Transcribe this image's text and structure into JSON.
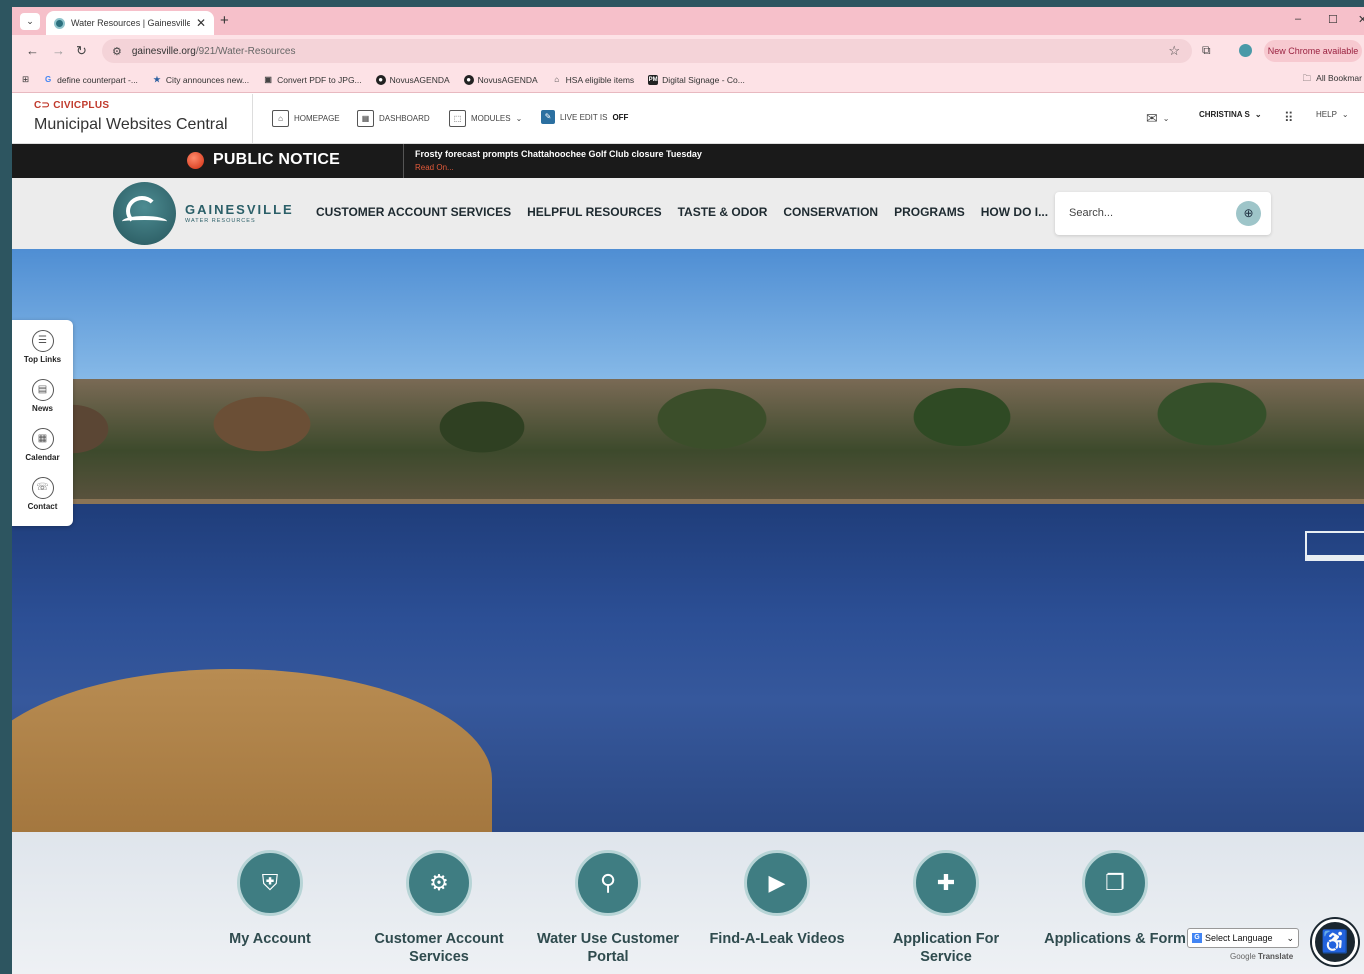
{
  "browser": {
    "tab_title": "Water Resources | Gainesville, G",
    "tab_close": "✕",
    "new_tab": "+",
    "window_buttons": [
      "–",
      "☐",
      "✕"
    ],
    "url_host": "gainesville.org",
    "url_path": "/921/Water-Resources",
    "update_button": "New Chrome available",
    "bookmarks": [
      {
        "icon": "google-icon",
        "label": "define counterpart -..."
      },
      {
        "icon": "city-icon",
        "label": "City announces new..."
      },
      {
        "icon": "convert-icon",
        "label": "Convert PDF to JPG..."
      },
      {
        "icon": "novus-icon",
        "label": "NovusAGENDA"
      },
      {
        "icon": "novus-icon",
        "label": "NovusAGENDA"
      },
      {
        "icon": "hsa-icon",
        "label": "HSA eligible items"
      },
      {
        "icon": "signage-icon",
        "label": "Digital Signage - Co..."
      }
    ],
    "all_bookmarks": "All Bookmar"
  },
  "admin_bar": {
    "brand": "CIVICPLUS",
    "brand_sub": "Municipal Websites Central",
    "homepage": "HOMEPAGE",
    "dashboard": "DASHBOARD",
    "modules": "MODULES",
    "live_edit_label": "LIVE EDIT IS",
    "live_edit_state": "OFF",
    "user": "CHRISTINA S",
    "help": "HELP"
  },
  "notice": {
    "title": "PUBLIC NOTICE",
    "headline": "Frosty forecast prompts Chattahoochee Golf Club closure Tuesday",
    "link": "Read On..."
  },
  "site": {
    "logo_name": "GAINESVILLE",
    "logo_sub": "WATER RESOURCES",
    "nav": [
      "CUSTOMER ACCOUNT SERVICES",
      "HELPFUL RESOURCES",
      "TASTE & ODOR",
      "CONSERVATION",
      "PROGRAMS",
      "HOW DO I..."
    ],
    "search_placeholder": "Search..."
  },
  "side_links": [
    {
      "icon": "list-icon",
      "label": "Top Links"
    },
    {
      "icon": "news-icon",
      "label": "News"
    },
    {
      "icon": "calendar-icon",
      "label": "Calendar"
    },
    {
      "icon": "contact-icon",
      "label": "Contact"
    }
  ],
  "cards": [
    {
      "icon": "shield-user-icon",
      "label": "My Account"
    },
    {
      "icon": "gear-people-icon",
      "label": "Customer Account Services"
    },
    {
      "icon": "faucet-icon",
      "label": "Water Use Customer Portal"
    },
    {
      "icon": "video-icon",
      "label": "Find-A-Leak Videos"
    },
    {
      "icon": "document-add-icon",
      "label": "Application For Service"
    },
    {
      "icon": "documents-icon",
      "label": "Applications & Form"
    }
  ],
  "translate": {
    "select_label": "Select Language",
    "powered_google": "Google",
    "powered_translate": "Translate"
  }
}
